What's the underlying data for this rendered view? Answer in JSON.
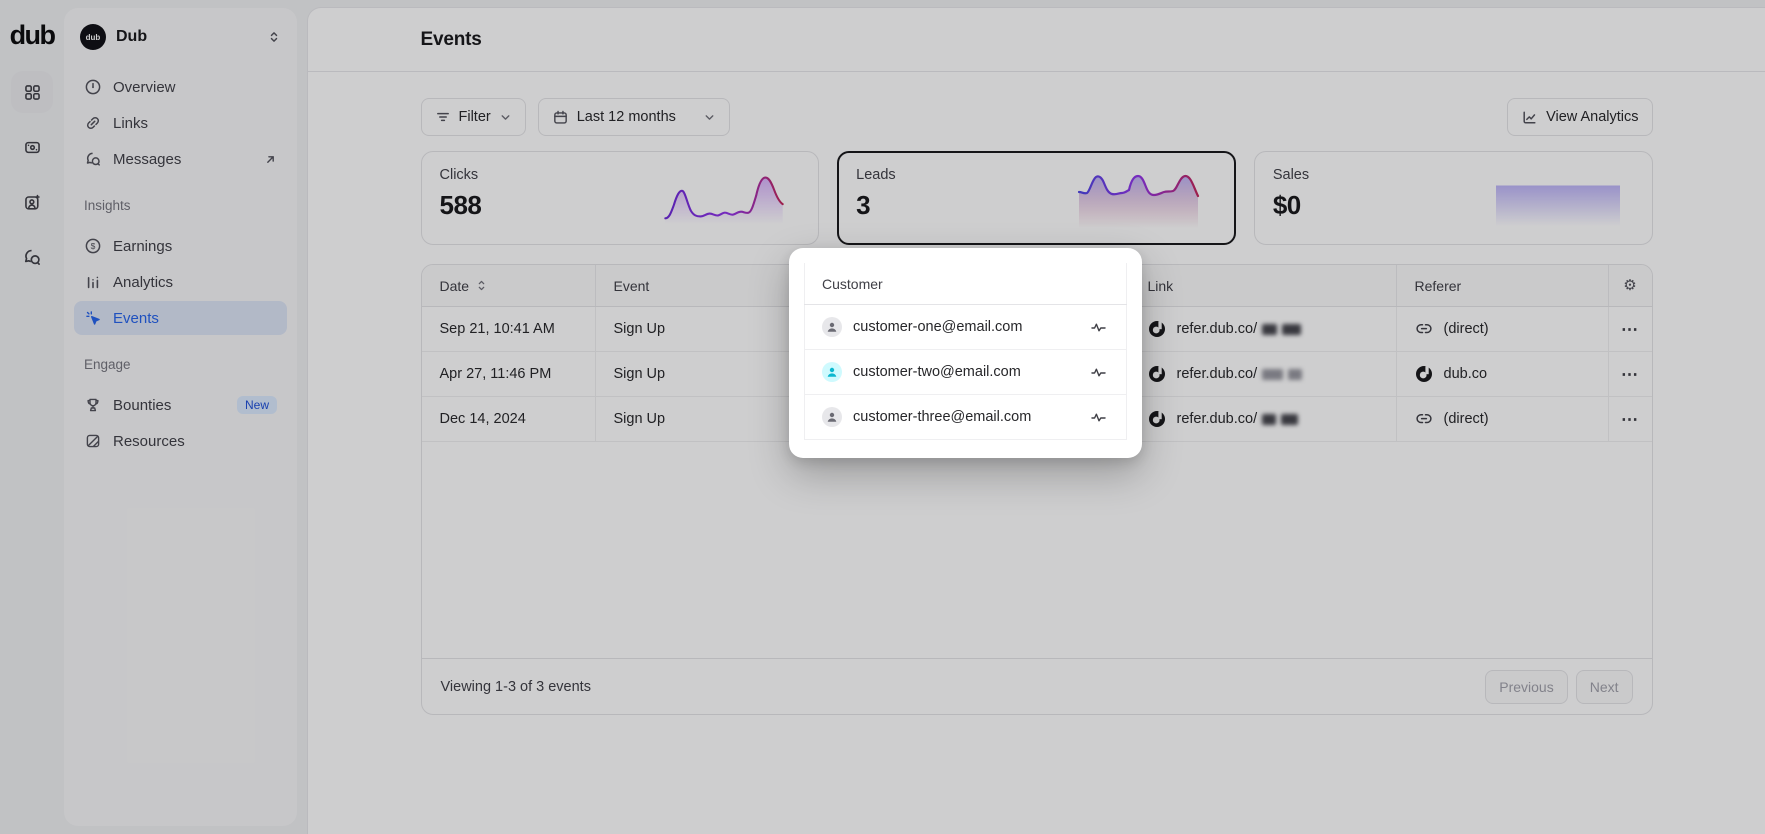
{
  "brand": {
    "wordmark": "dub",
    "workspace_name": "Dub",
    "workspace_avatar_text": "dub"
  },
  "rail": {
    "items": [
      {
        "icon": "grid-icon",
        "active": true
      },
      {
        "icon": "wallet-icon",
        "active": false
      },
      {
        "icon": "user-plus-icon",
        "active": false
      },
      {
        "icon": "chat-icon",
        "active": false
      }
    ]
  },
  "sidebar": {
    "main_items": [
      {
        "icon": "gauge-icon",
        "label": "Overview"
      },
      {
        "icon": "link-icon",
        "label": "Links"
      },
      {
        "icon": "chat-bubble-icon",
        "label": "Messages",
        "trailing_icon": "arrow-up-right-icon"
      }
    ],
    "sections": [
      {
        "title": "Insights",
        "items": [
          {
            "icon": "dollar-circle-icon",
            "label": "Earnings"
          },
          {
            "icon": "bar-chart-icon",
            "label": "Analytics"
          },
          {
            "icon": "cursor-click-icon",
            "label": "Events",
            "active": true
          }
        ]
      },
      {
        "title": "Engage",
        "items": [
          {
            "icon": "trophy-icon",
            "label": "Bounties",
            "badge": "New"
          },
          {
            "icon": "book-icon",
            "label": "Resources"
          }
        ]
      }
    ]
  },
  "header": {
    "title": "Events"
  },
  "toolbar": {
    "filter_label": "Filter",
    "date_range": "Last 12 months",
    "view_analytics_label": "View Analytics"
  },
  "stats": [
    {
      "label": "Clicks",
      "value": "588",
      "selected": false
    },
    {
      "label": "Leads",
      "value": "3",
      "selected": true
    },
    {
      "label": "Sales",
      "value": "$0",
      "selected": false
    }
  ],
  "table": {
    "columns": [
      "Date",
      "Event",
      "Customer",
      "Link",
      "Referer"
    ],
    "rows": [
      {
        "date": "Sep 21, 10:41 AM",
        "event": "Sign Up",
        "customer_email": "customer-one@email.com",
        "link_host": "refer.dub.co/",
        "link_redacted": true,
        "referer": "(direct)",
        "referer_icon": "link-chain-icon"
      },
      {
        "date": "Apr 27, 11:46 PM",
        "event": "Sign Up",
        "customer_email": "customer-two@email.com",
        "link_host": "refer.dub.co/",
        "link_redacted": true,
        "referer": "dub.co",
        "referer_icon": "dub-logo-icon"
      },
      {
        "date": "Dec 14, 2024",
        "event": "Sign Up",
        "customer_email": "customer-three@email.com",
        "link_host": "refer.dub.co/",
        "link_redacted": true,
        "referer": "(direct)",
        "referer_icon": "link-chain-icon"
      }
    ],
    "footer": {
      "viewing_text": "Viewing 1-3 of 3 events",
      "previous_label": "Previous",
      "next_label": "Next"
    }
  },
  "spotlight": {
    "column_title": "Customer"
  },
  "icons": {
    "gear": "⚙",
    "ellipsis": "⋯"
  },
  "colors": {
    "accent_blue": "#2563eb",
    "badge_bg": "#dbeafe",
    "selected_card_border": "#18181b",
    "spark_indigo": "#5b51d8",
    "spark_purple": "#9333ea",
    "spark_pink": "#d6336c"
  }
}
